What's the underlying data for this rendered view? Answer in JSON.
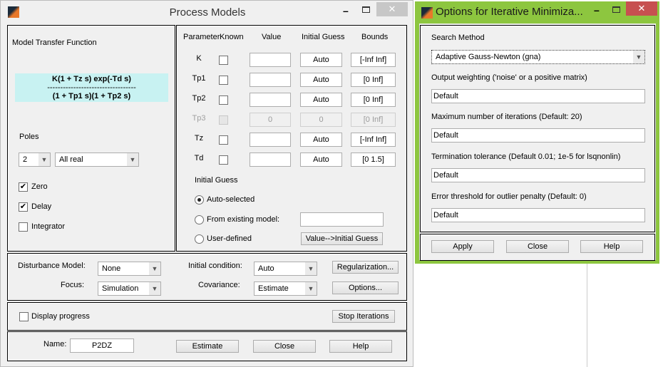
{
  "process_models": {
    "title": "Process Models",
    "model_tf_label": "Model Transfer Function",
    "tf_numerator": "K(1 + Tz s) exp(-Td s)",
    "tf_divider": "----------------------------------",
    "tf_denominator": "(1 + Tp1 s)(1 + Tp2 s)",
    "poles_label": "Poles",
    "poles_count": "2",
    "poles_type": "All real",
    "zero": {
      "label": "Zero",
      "checked": true
    },
    "delay": {
      "label": "Delay",
      "checked": true
    },
    "integrator": {
      "label": "Integrator",
      "checked": false
    },
    "headers": {
      "parameter": "Parameter",
      "known": "Known",
      "value": "Value",
      "initial_guess": "Initial Guess",
      "bounds": "Bounds"
    },
    "params": [
      {
        "name": "K",
        "value": "",
        "initial": "Auto",
        "bounds": "[-Inf Inf]",
        "enabled": true
      },
      {
        "name": "Tp1",
        "value": "",
        "initial": "Auto",
        "bounds": "[0 Inf]",
        "enabled": true
      },
      {
        "name": "Tp2",
        "value": "",
        "initial": "Auto",
        "bounds": "[0 Inf]",
        "enabled": true
      },
      {
        "name": "Tp3",
        "value": "0",
        "initial": "0",
        "bounds": "[0 Inf]",
        "enabled": false
      },
      {
        "name": "Tz",
        "value": "",
        "initial": "Auto",
        "bounds": "[-Inf Inf]",
        "enabled": true
      },
      {
        "name": "Td",
        "value": "",
        "initial": "Auto",
        "bounds": "[0 1.5]",
        "enabled": true
      }
    ],
    "initial_guess": {
      "title": "Initial Guess",
      "auto": "Auto-selected",
      "existing": "From existing model:",
      "existing_value": "",
      "user": "User-defined",
      "value_button": "Value-->Initial Guess",
      "selected": "auto"
    },
    "disturbance_label": "Disturbance Model:",
    "disturbance_value": "None",
    "focus_label": "Focus:",
    "focus_value": "Simulation",
    "initcond_label": "Initial condition:",
    "initcond_value": "Auto",
    "covariance_label": "Covariance:",
    "covariance_value": "Estimate",
    "regularization_button": "Regularization...",
    "options_button": "Options...",
    "display_progress": {
      "label": "Display progress",
      "checked": false
    },
    "stop_button": "Stop Iterations",
    "name_label": "Name:",
    "name_value": "P2DZ",
    "estimate_button": "Estimate",
    "close_button": "Close",
    "help_button": "Help"
  },
  "options": {
    "title": "Options for Iterative Minimiza...",
    "search_label": "Search Method",
    "search_value": "Adaptive Gauss-Newton (gna)",
    "weight_label": "Output weighting ('noise' or a positive matrix)",
    "weight_value": "Default",
    "maxiter_label": "Maximum number of iterations (Default: 20)",
    "maxiter_value": "Default",
    "tol_label": "Termination tolerance (Default 0.01; 1e-5 for lsqnonlin)",
    "tol_value": "Default",
    "err_label": "Error threshold for outlier penalty (Default: 0)",
    "err_value": "Default",
    "apply_button": "Apply",
    "close_button": "Close",
    "help_button": "Help",
    "border_color": "#8dc63f"
  }
}
